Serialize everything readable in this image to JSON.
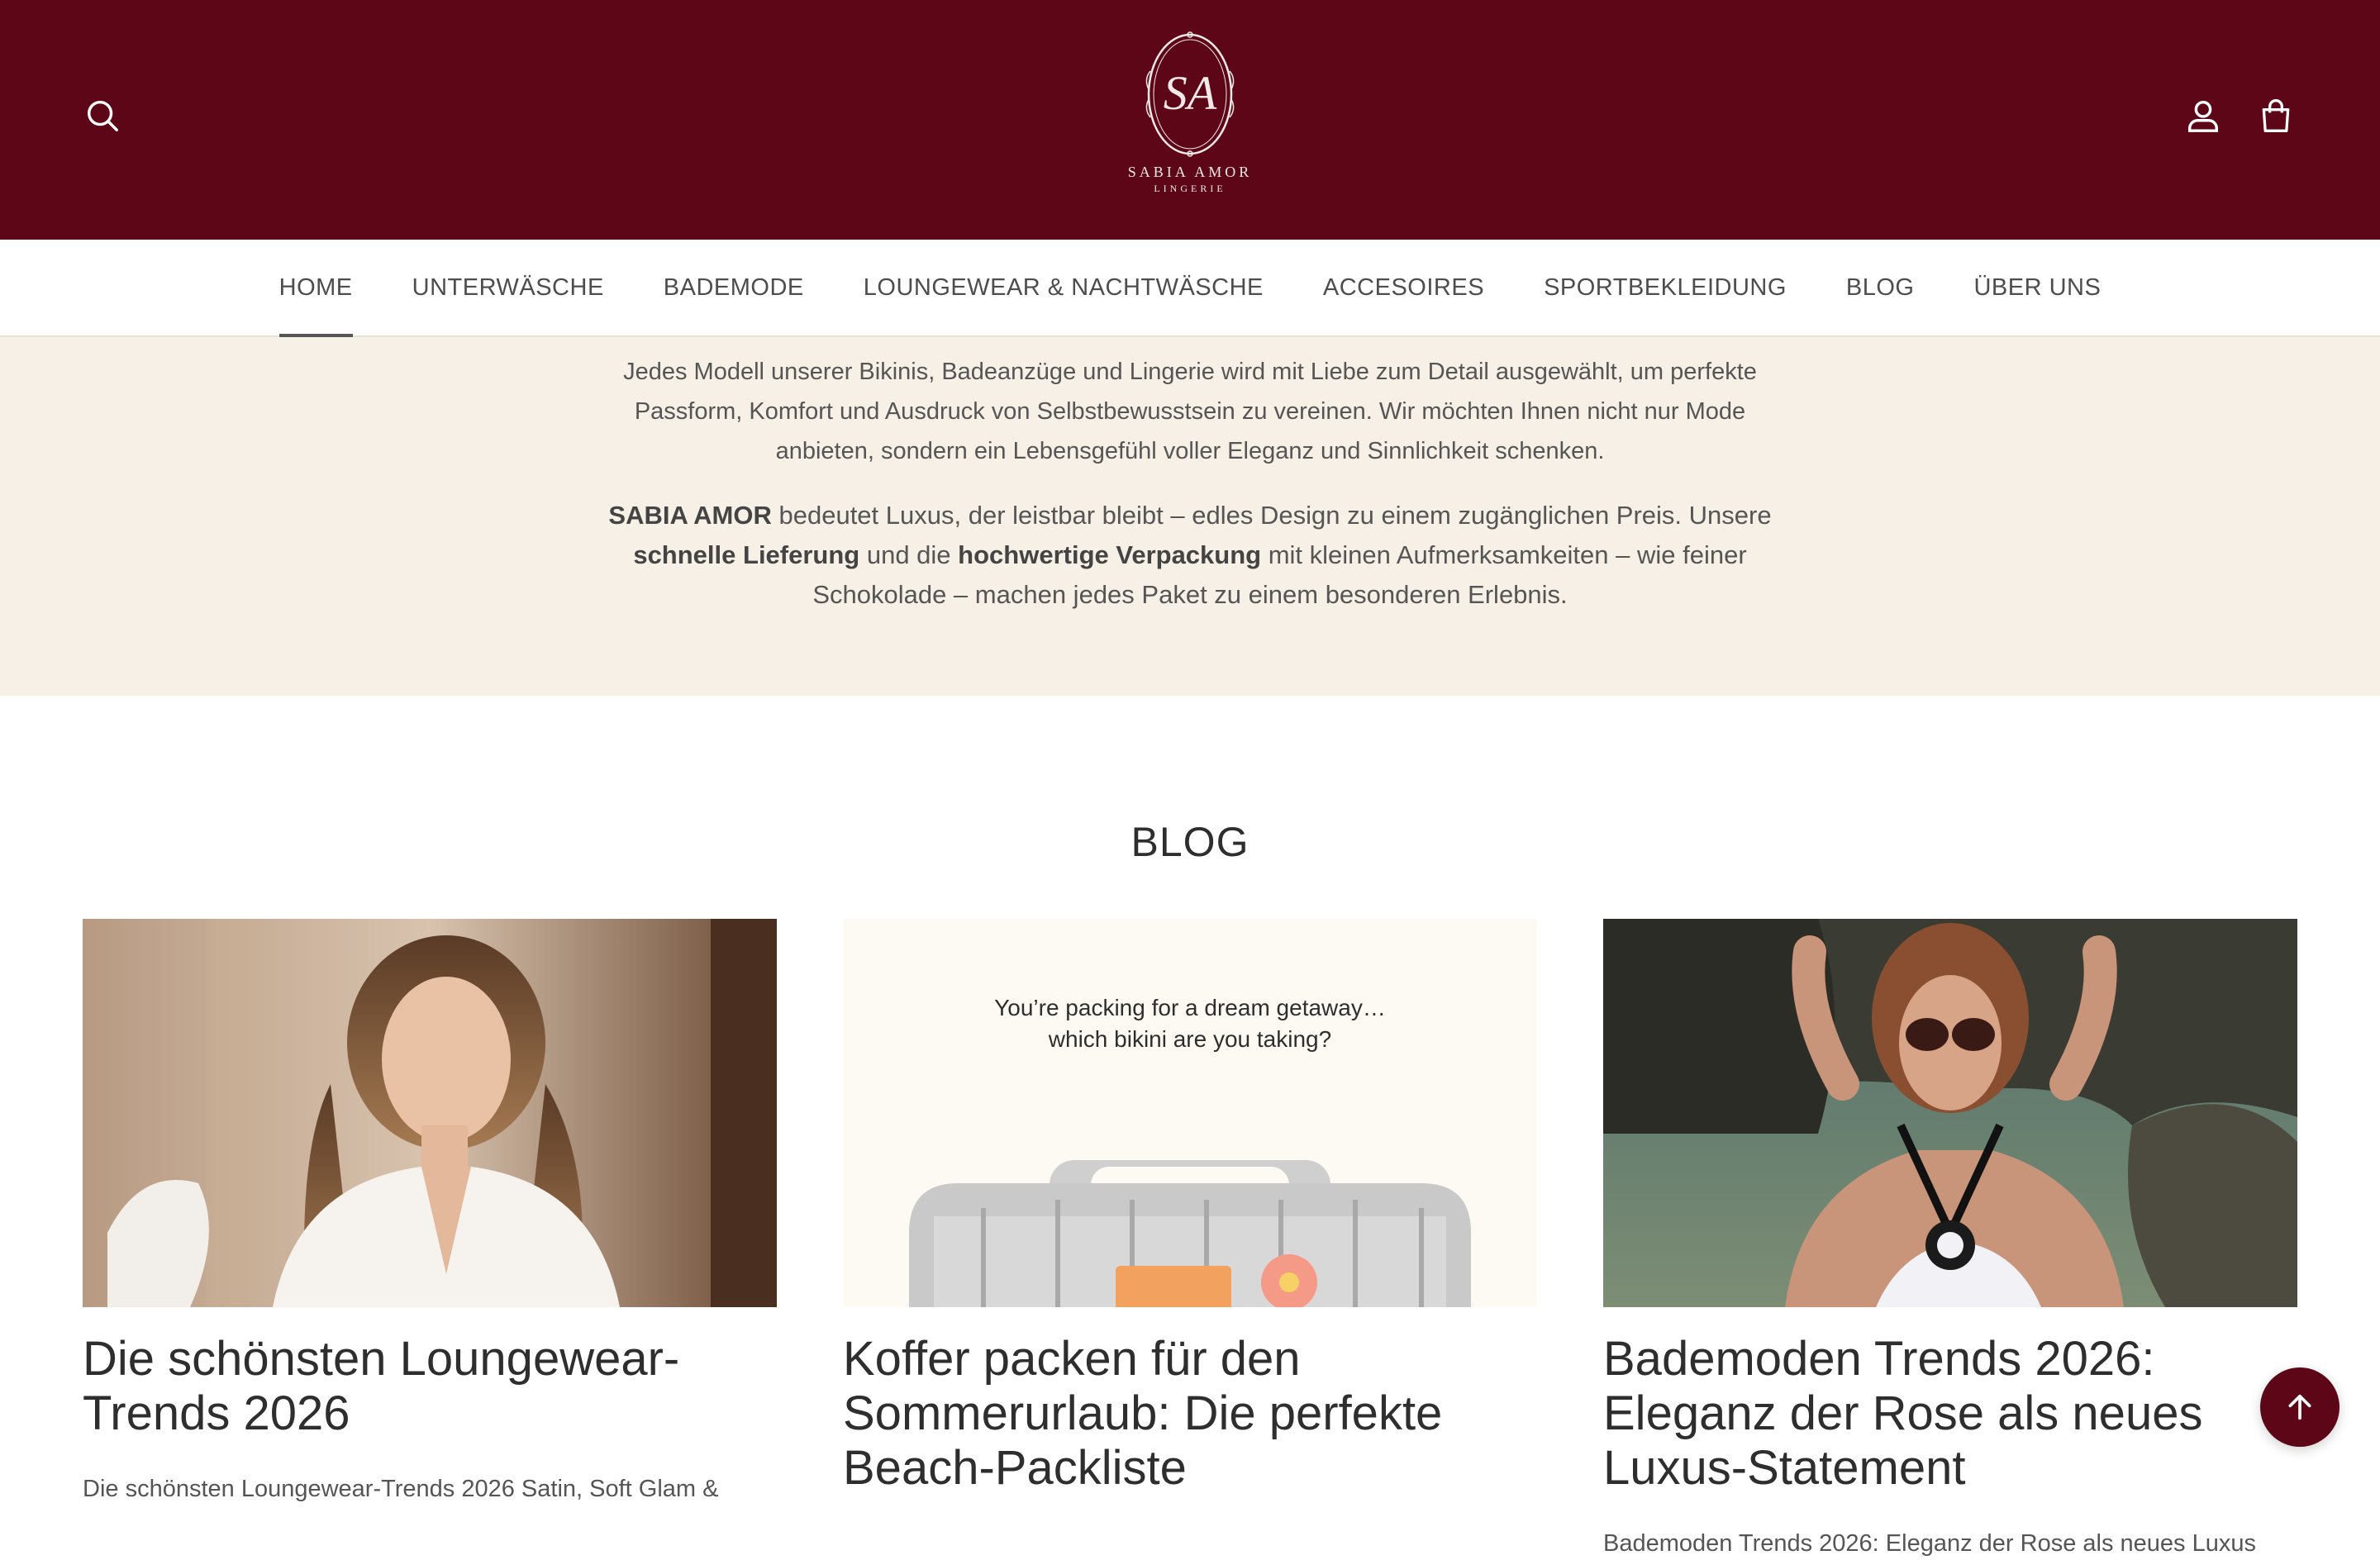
{
  "brand": {
    "name": "SABIA AMOR",
    "subtitle": "LINGERIE",
    "monogram": "SA",
    "header_color": "#5c0617",
    "cream_bg": "#f7f0e6"
  },
  "header": {
    "search_icon": "search-icon",
    "account_icon": "user-icon",
    "cart_icon": "shopping-bag-icon"
  },
  "nav": {
    "items": [
      {
        "label": "HOME",
        "active": true
      },
      {
        "label": "UNTERWÄSCHE",
        "active": false
      },
      {
        "label": "BADEMODE",
        "active": false
      },
      {
        "label": "LOUNGEWEAR & NACHTWÄSCHE",
        "active": false
      },
      {
        "label": "ACCESOIRES",
        "active": false
      },
      {
        "label": "SPORTBEKLEIDUNG",
        "active": false
      },
      {
        "label": "BLOG",
        "active": false
      },
      {
        "label": "ÜBER UNS",
        "active": false
      }
    ]
  },
  "about": {
    "paragraph1": "Jedes Modell unserer Bikinis, Badeanzüge und Lingerie wird mit Liebe zum Detail ausgewählt, um perfekte Passform, Komfort und Ausdruck von Selbstbewusstsein zu vereinen. Wir möchten Ihnen nicht nur Mode anbieten, sondern ein Lebensgefühl voller Eleganz und Sinnlichkeit schenken.",
    "p2_brand": "SABIA AMOR",
    "p2_text1": " bedeutet Luxus, der leistbar bleibt – edles Design zu einem zugänglichen Preis. Unsere ",
    "p2_bold1": "schnelle Lieferung",
    "p2_text2": " und die ",
    "p2_bold2": "hochwertige Verpackung",
    "p2_text3": " mit kleinen Aufmerksamkeiten – wie feiner Schokolade – machen jedes Paket zu einem besonderen Erlebnis."
  },
  "blog": {
    "heading": "BLOG",
    "posts": [
      {
        "title": "Die schönsten Loungewear-Trends 2026",
        "excerpt": "Die schönsten Loungewear-Trends 2026 Satin, Soft Glam &"
      },
      {
        "title": "Koffer packen für den Sommerurlaub: Die perfekte Beach-Packliste",
        "image_line1": "You’re packing for a dream getaway…",
        "image_line2": "which bikini are you taking?"
      },
      {
        "title": "Bademoden Trends 2026: Eleganz der Rose als neues Luxus-Statement",
        "excerpt": "Bademoden Trends 2026: Eleganz der Rose als neues Luxus"
      }
    ]
  },
  "back_to_top_icon": "arrow-up-icon"
}
